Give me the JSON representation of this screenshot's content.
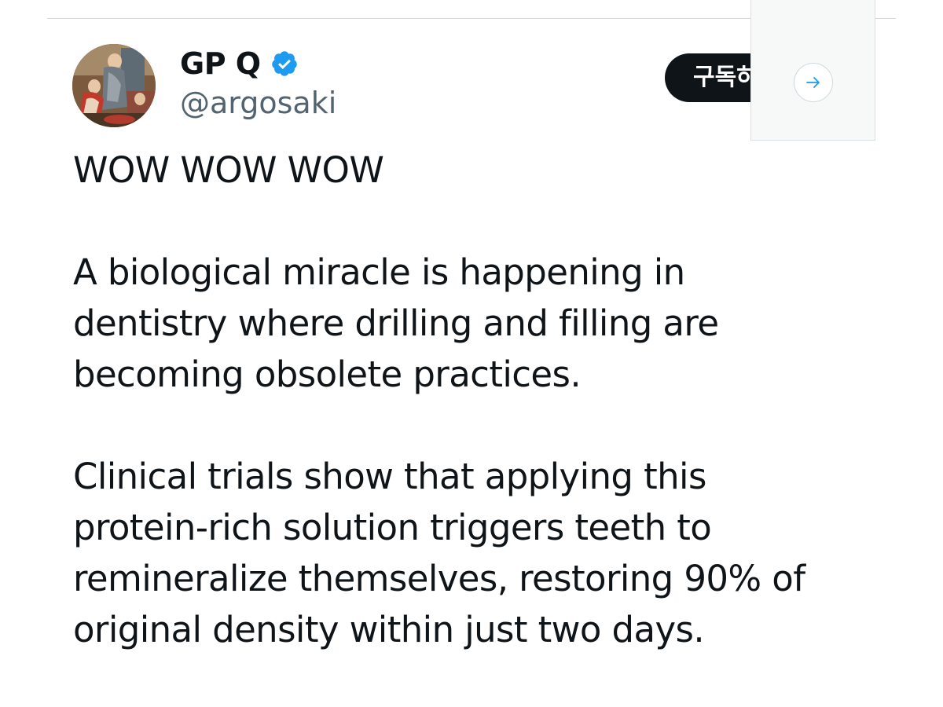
{
  "tweet": {
    "author": {
      "display_name": "GP Q",
      "handle": "@argosaki",
      "verified": true,
      "verified_color": "#1d9bf0"
    },
    "subscribe_label": "구독하",
    "text_lines": [
      "WOW WOW WOW",
      "A biological miracle is happening in",
      "dentistry where drilling and filling are",
      "becoming obsolete practices.",
      "Clinical trials show that applying this",
      "protein-rich solution triggers teeth to",
      "remineralize themselves, restoring 90% of",
      "original density within just two days."
    ]
  },
  "icons": {
    "verified": "verified-badge-icon",
    "arrow": "arrow-right-icon",
    "avatar": "profile-avatar"
  },
  "colors": {
    "text_primary": "#0f1419",
    "text_secondary": "#536471",
    "button_dark": "#0f1419",
    "accent_blue": "#1d9bf0"
  }
}
